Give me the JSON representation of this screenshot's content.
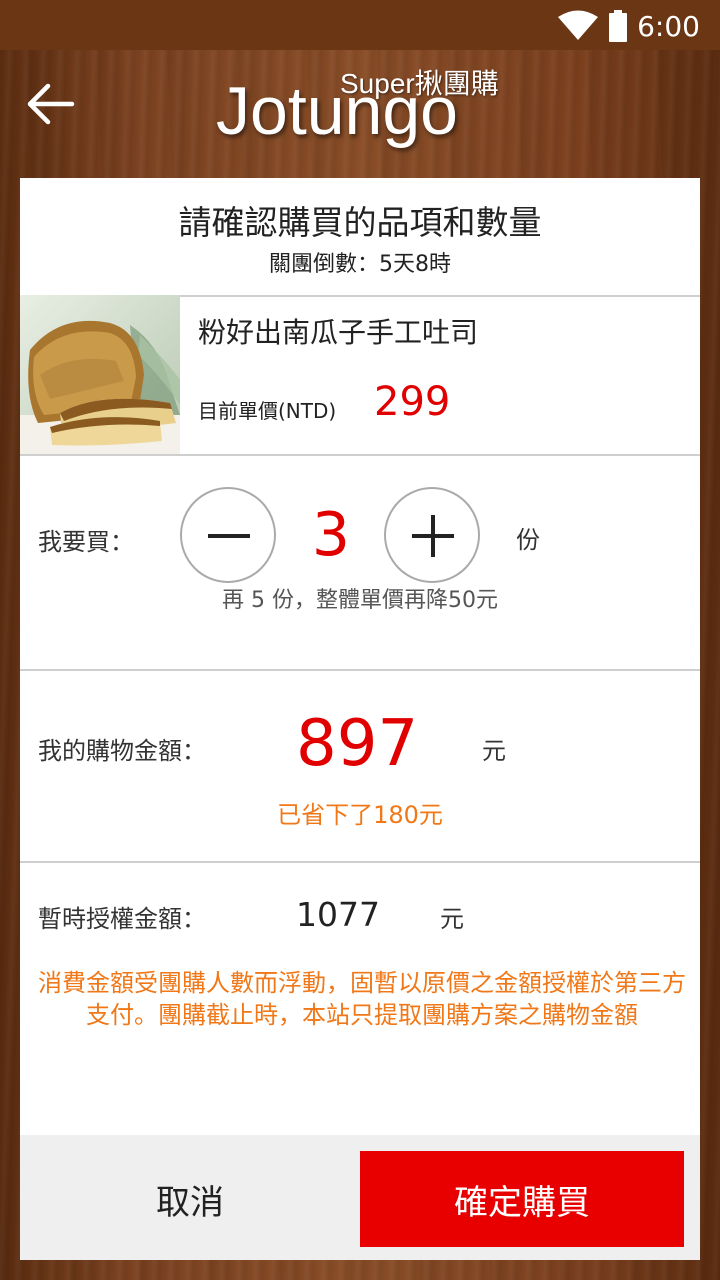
{
  "status_bar": {
    "time": "6:00",
    "wifi_icon": "wifi-icon",
    "battery_icon": "battery-icon"
  },
  "header": {
    "back_icon": "arrow-left-icon",
    "logo_super": "Super揪團購",
    "logo_main": "Jotungo"
  },
  "confirm": {
    "title": "請確認購買的品項和數量",
    "countdown": "關團倒數：5天8時"
  },
  "product": {
    "name": "粉好出南瓜子手工吐司",
    "price_label": "目前單價(NTD)",
    "price": "299"
  },
  "quantity": {
    "label": "我要買：",
    "value": "3",
    "unit": "份",
    "minus_icon": "minus-icon",
    "plus_icon": "plus-icon",
    "hint": "再 5 份，整體單價再降50元"
  },
  "total": {
    "label": "我的購物金額：",
    "value": "897",
    "unit": "元",
    "saved": "已省下了180元"
  },
  "authorization": {
    "label": "暫時授權金額：",
    "value": "1077",
    "unit": "元",
    "note": "消費金額受團購人數而浮動，固暫以原價之金額授權於第三方支付。團購截止時，本站只提取團購方案之購物金額"
  },
  "actions": {
    "cancel": "取消",
    "confirm": "確定購買"
  },
  "colors": {
    "accent_red": "#e80000",
    "note_orange": "#f07818"
  }
}
